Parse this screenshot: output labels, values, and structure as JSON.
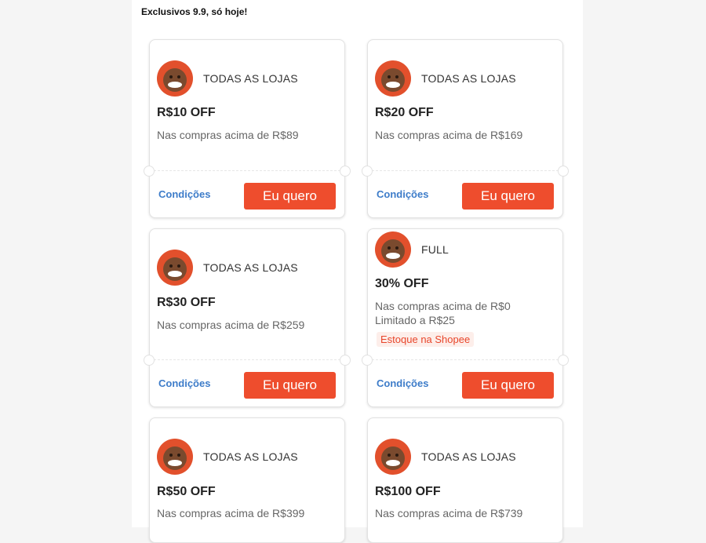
{
  "header": {
    "title": "Exclusivos 9.9, só hoje!"
  },
  "coupons": [
    {
      "store": "TODAS AS LOJAS",
      "title": "R$10 OFF",
      "desc": "Nas compras acima de R$89",
      "conditions": "Condições",
      "cta": "Eu quero"
    },
    {
      "store": "TODAS AS LOJAS",
      "title": "R$20 OFF",
      "desc": "Nas compras acima de R$169",
      "conditions": "Condições",
      "cta": "Eu quero"
    },
    {
      "store": "TODAS AS LOJAS",
      "title": "R$30 OFF",
      "desc": "Nas compras acima de R$259",
      "conditions": "Condições",
      "cta": "Eu quero"
    },
    {
      "store": "FULL",
      "title": "30% OFF",
      "desc": "Nas compras acima de R$0",
      "desc2": "Limitado a R$25",
      "tag": "Estoque na Shopee",
      "conditions": "Condições",
      "cta": "Eu quero"
    },
    {
      "store": "TODAS AS LOJAS",
      "title": "R$50 OFF",
      "desc": "Nas compras acima de R$399"
    },
    {
      "store": "TODAS AS LOJAS",
      "title": "R$100 OFF",
      "desc": "Nas compras acima de R$739"
    }
  ],
  "colors": {
    "accent": "#ee4d2d",
    "link": "#3d7cc9",
    "tag_bg": "#fdeeea"
  }
}
